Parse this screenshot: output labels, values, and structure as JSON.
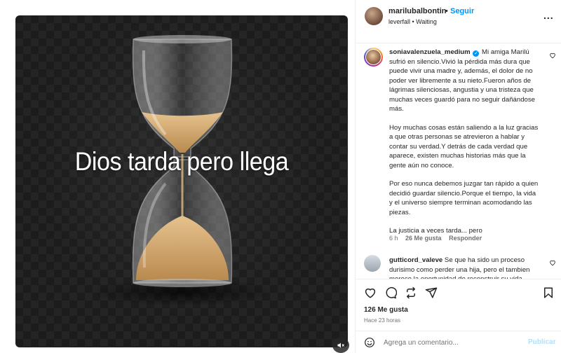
{
  "media": {
    "image_text": "Dios tarda pero llega",
    "mute_icon": "speaker-muted-icon"
  },
  "header": {
    "username": "marilubalbontin",
    "dot": "•",
    "follow_label": "Seguir",
    "subtitle": "leverfall • Waiting",
    "more_icon": "more-options-icon",
    "more_label": "..."
  },
  "caption": {
    "username": "soniavalenzuela_medium",
    "verified_mark": "✓",
    "first_paragraph": "Mi amiga Marilú sufrió en silencio.Vivió la pérdida más dura que puede vivir una madre y, además, el dolor de no poder ver libremente a su nieto.Fueron años de lágrimas silenciosas, angustia y una tristeza que muchas veces guardó para no seguir dañándose más.",
    "paragraphs": [
      "Hoy muchas cosas están saliendo a la luz gracias a que otras personas se atrevieron a hablar y contar su verdad.Y detrás de cada verdad que aparece, existen muchas historias más que la gente aún no conoce.",
      "Por eso nunca debemos juzgar tan rápido a quien decidió guardar silencio.Porque el tiempo, la vida y el universo siempre terminan acomodando las piezas.",
      "La justicia a veces tarda... pero"
    ],
    "time": "6 h",
    "likes": "26 Me gusta",
    "reply_label": "Responder"
  },
  "comment2": {
    "username": "gutticord_valeve",
    "text": "Se que ha sido un proceso durisimo como perder una hija, pero el tambien merece la oportunidad de reconstruir su vida"
  },
  "actions": {
    "likes_count": "126 Me gusta",
    "time": "Hace 23 horas",
    "icons": [
      "heart-icon",
      "comment-icon",
      "repost-icon",
      "share-icon",
      "bookmark-icon"
    ]
  },
  "add_comment": {
    "placeholder": "Agrega un comentario...",
    "post_label": "Publicar",
    "emoji_icon": "emoji-icon"
  },
  "colors": {
    "link_blue": "#0095f6",
    "post_disabled": "#b2dffc",
    "muted_text": "#737373",
    "sand": "#c9a06a"
  }
}
